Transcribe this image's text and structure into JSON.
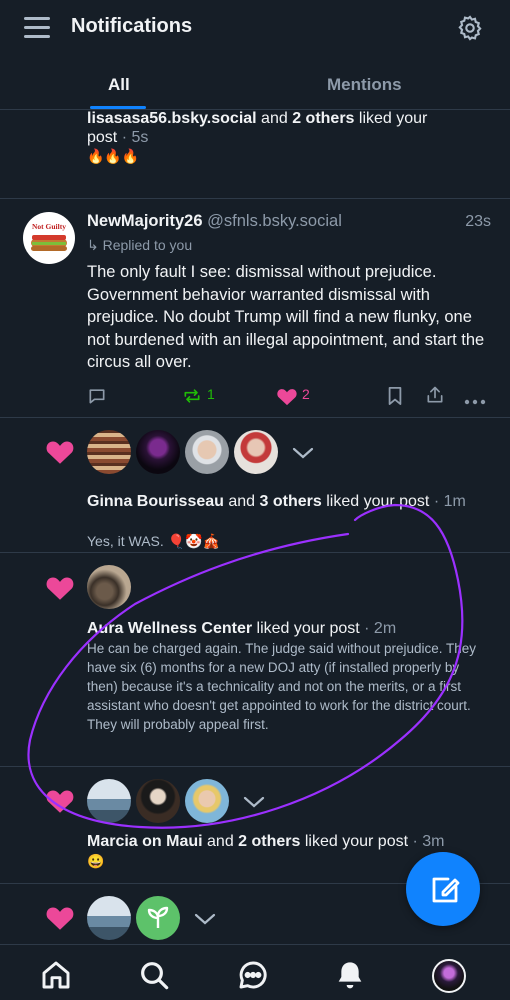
{
  "header": {
    "title": "Notifications"
  },
  "tabs": [
    {
      "label": "All",
      "active": true
    },
    {
      "label": "Mentions",
      "active": false
    }
  ],
  "feed": {
    "item1": {
      "actor": "lisasasa56.bsky.social",
      "connector": " and ",
      "others": "2 others",
      "action": " liked your",
      "line2": "post",
      "time": " · 5s",
      "body": "🔥🔥🔥"
    },
    "reply": {
      "avatar_text": "Not Guilty",
      "display_name": "NewMajority26",
      "handle": "@sfnls.bsky.social",
      "time": "23s",
      "replied_to": "↳ Replied to you",
      "text": "The only fault I see: dismissal without prejudice. Government behavior warranted dismissal with prejudice. No doubt Trump will find a new flunky, one not burdened with an illegal appointment, and start the circus all over.",
      "reposts": "1",
      "likes": "2"
    },
    "item3": {
      "actor": "Ginna Bourisseau",
      "connector": " and ",
      "others": "3 others",
      "action": " liked your post",
      "time": " · 1m",
      "body": "Yes, it WAS. 🎈🤡🎪"
    },
    "item4": {
      "actor": "Aura Wellness Center",
      "action": " liked your post",
      "time": " · 2m",
      "body": "He can be charged again. The judge said without prejudice. They have six (6) months for a new DOJ atty (if installed properly by then) because it's a technicality and not on the merits, or a first assistant who doesn't get appointed to work for the district court. They will probably appeal first."
    },
    "item5": {
      "actor": "Marcia on Maui",
      "connector": " and ",
      "others": "2 others",
      "action": " liked your post",
      "time": " · 3m",
      "body": "😀"
    }
  },
  "colors": {
    "accent": "#1083fe",
    "like": "#ec4899",
    "repost": "#20bc07",
    "annotation": "#9b30ff",
    "background": "#161e27"
  }
}
